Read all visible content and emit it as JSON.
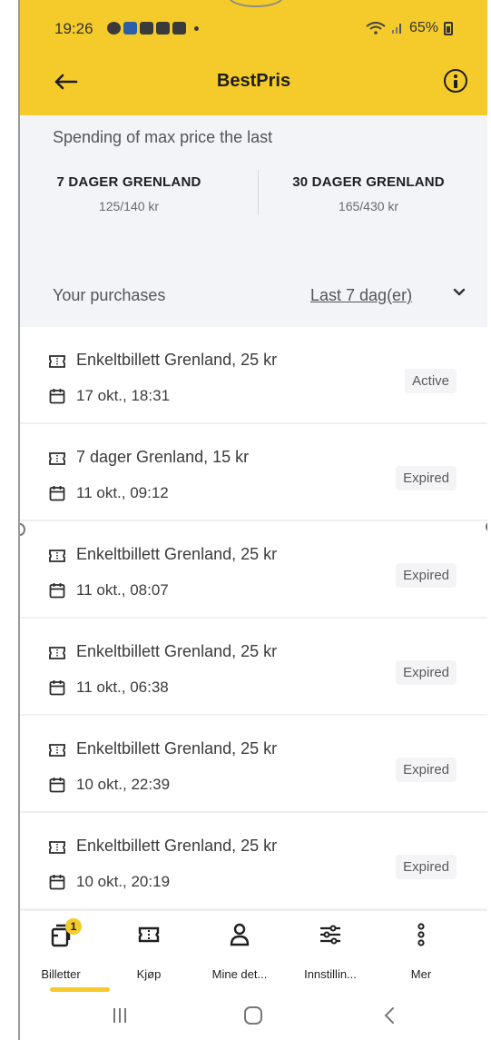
{
  "status": {
    "time": "19:26",
    "battery": "65%"
  },
  "appbar": {
    "title": "BestPris"
  },
  "spending": {
    "title": "Spending of max price the last",
    "left": {
      "name": "7 DAGER GRENLAND",
      "value": "125/140 kr"
    },
    "right": {
      "name": "30 DAGER GRENLAND",
      "value": "165/430 kr"
    }
  },
  "purchases": {
    "label": "Your purchases",
    "filter": "Last 7 dag(er)"
  },
  "items": [
    {
      "title": "Enkeltbillett Grenland, 25 kr",
      "date": "17 okt., 18:31",
      "status": "Active"
    },
    {
      "title": "7 dager Grenland, 15 kr",
      "date": "11 okt., 09:12",
      "status": "Expired"
    },
    {
      "title": "Enkeltbillett Grenland, 25 kr",
      "date": "11 okt., 08:07",
      "status": "Expired"
    },
    {
      "title": "Enkeltbillett Grenland, 25 kr",
      "date": "11 okt., 06:38",
      "status": "Expired"
    },
    {
      "title": "Enkeltbillett Grenland, 25 kr",
      "date": "10 okt., 22:39",
      "status": "Expired"
    },
    {
      "title": "Enkeltbillett Grenland, 25 kr",
      "date": "10 okt., 20:19",
      "status": "Expired"
    }
  ],
  "nav": {
    "items": [
      {
        "label": "Billetter",
        "icon": "ticket-stack-icon",
        "badge": "1"
      },
      {
        "label": "Kjøp",
        "icon": "ticket-icon"
      },
      {
        "label": "Mine det...",
        "icon": "person-icon"
      },
      {
        "label": "Innstillin...",
        "icon": "sliders-icon"
      },
      {
        "label": "Mer",
        "icon": "more-vertical-icon"
      }
    ]
  },
  "colors": {
    "brand_yellow": "#f4cb2a",
    "section_bg": "#f3f4f8"
  }
}
